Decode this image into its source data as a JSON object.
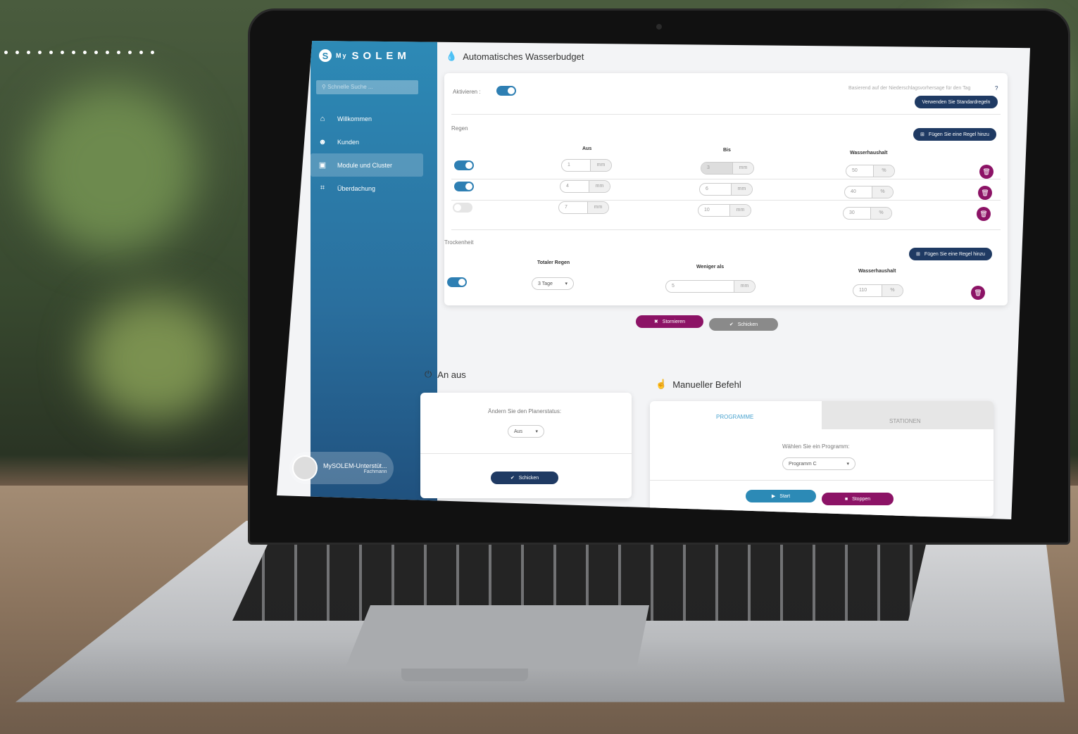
{
  "app": {
    "brand_my": "My",
    "brand_name": "SOLEM"
  },
  "sidebar": {
    "search_placeholder": "Schnelle Suche ...",
    "items": [
      {
        "icon": "home-icon",
        "label": "Willkommen"
      },
      {
        "icon": "users-icon",
        "label": "Kunden"
      },
      {
        "icon": "module-icon",
        "label": "Module und Cluster"
      },
      {
        "icon": "coverage-icon",
        "label": "Überdachung"
      }
    ],
    "user": {
      "name": "MySOLEM-Unterstüt...",
      "role": "Fachmann"
    }
  },
  "budget": {
    "title": "Automatisches Wasserbudget",
    "activate_label": "Aktivieren :",
    "forecast_note": "Basierend auf der Niederschlagsvorhersage für den Tag",
    "default_rules_button": "Verwenden Sie Standardregeln",
    "rain": {
      "label": "Regen",
      "add_rule_button": "Fügen Sie eine Regel hinzu",
      "col_from": "Aus",
      "col_to": "Bis",
      "col_budget": "Wasserhaushalt",
      "rows": [
        {
          "enabled": true,
          "from": "1",
          "to": "3",
          "budget": "50",
          "unit": "mm",
          "pct": "%"
        },
        {
          "enabled": true,
          "from": "4",
          "to": "6",
          "budget": "40",
          "unit": "mm",
          "pct": "%"
        },
        {
          "enabled": false,
          "from": "7",
          "to": "10",
          "budget": "30",
          "unit": "mm",
          "pct": "%"
        }
      ]
    },
    "drought": {
      "label": "Trockenheit",
      "add_rule_button": "Fügen Sie eine Regel hinzu",
      "col_total": "Totaler Regen",
      "col_less": "Weniger als",
      "col_budget": "Wasserhaushalt",
      "total": "3 Tage",
      "less": "5",
      "unit": "mm",
      "budget": "110",
      "pct": "%"
    },
    "cancel_button": "Stornieren",
    "send_button": "Schicken"
  },
  "onoff": {
    "title": "An aus",
    "label": "Ändern Sie den Planerstatus:",
    "value": "Aus",
    "send_button": "Schicken"
  },
  "manual": {
    "title": "Manueller Befehl",
    "tab_programs": "PROGRAMME",
    "tab_stations": "STATIONEN",
    "label": "Wählen Sie ein Programm:",
    "program": "Programm C",
    "start_button": "Start",
    "stop_button": "Stoppen"
  }
}
